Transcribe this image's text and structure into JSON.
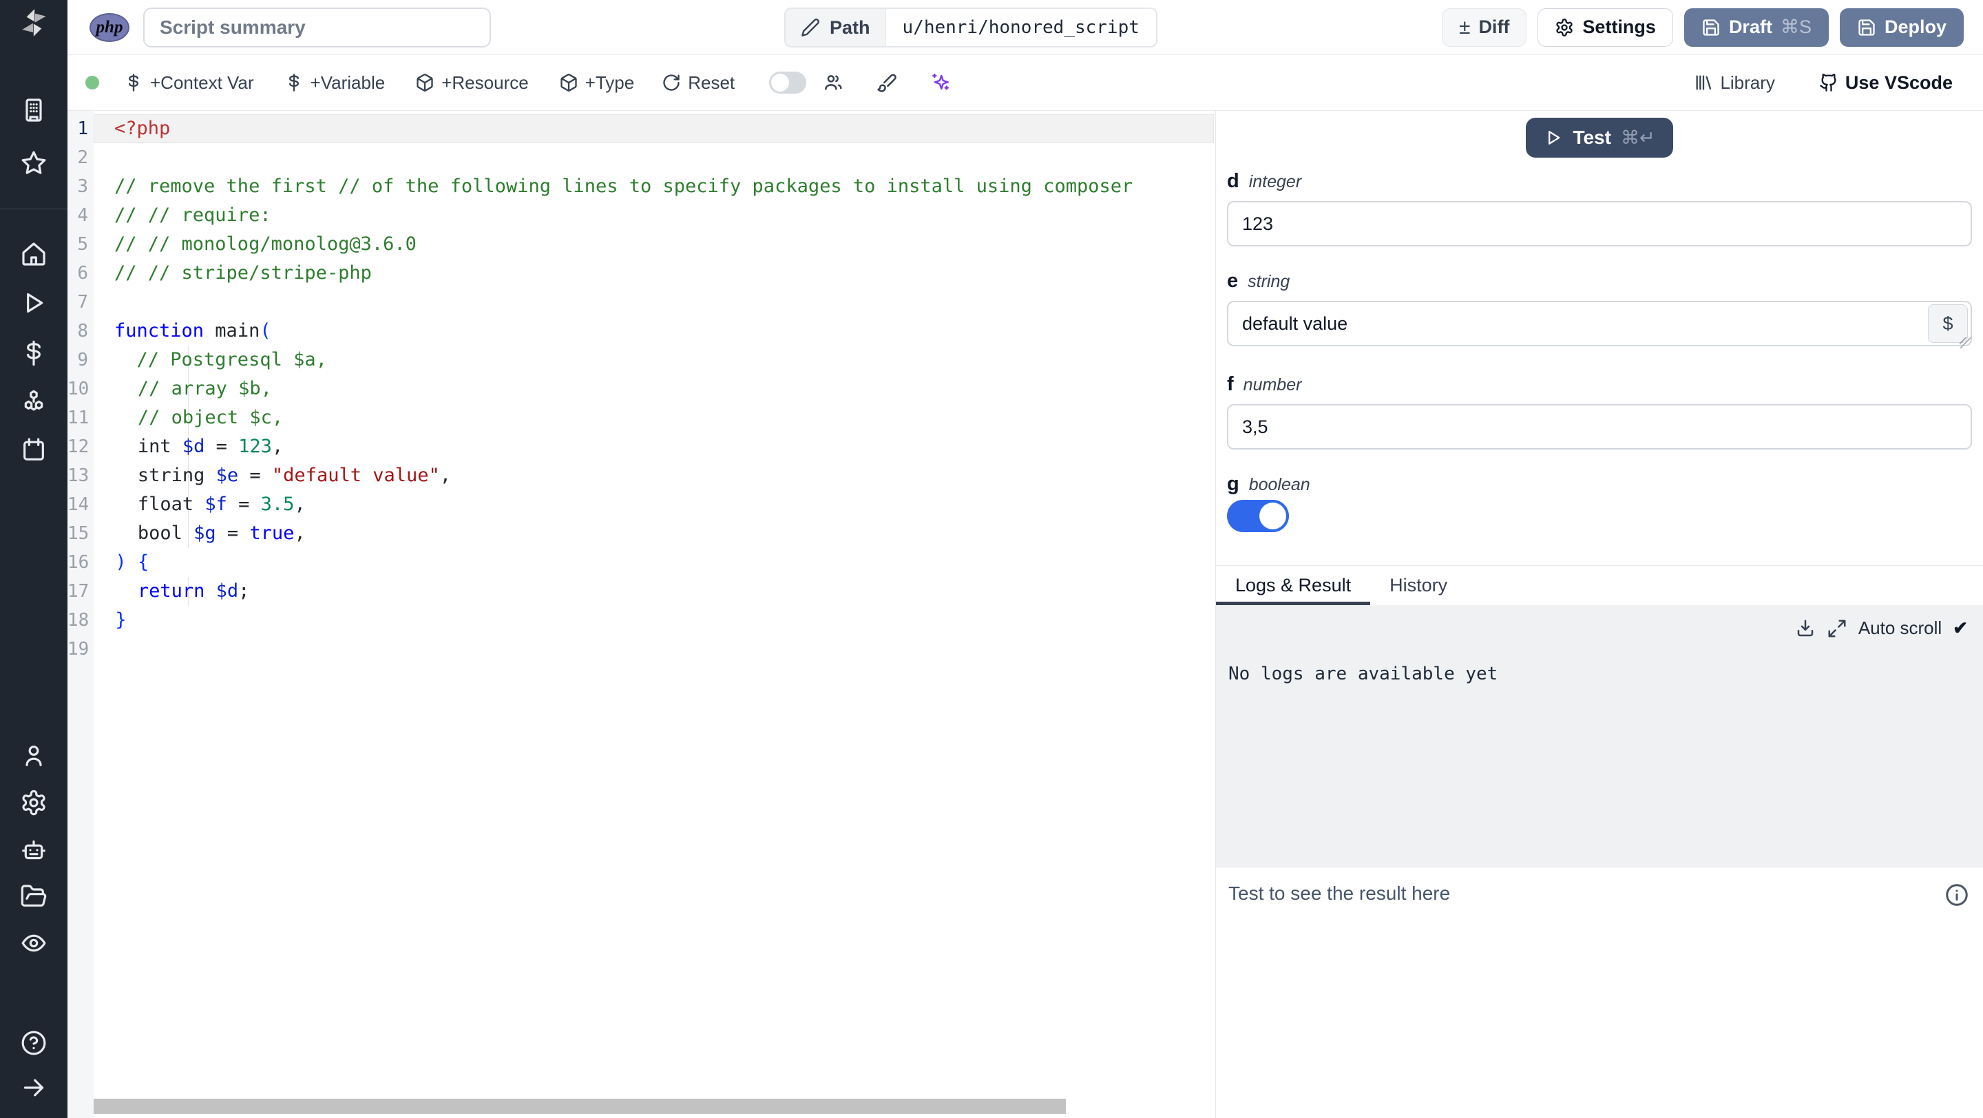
{
  "colors": {
    "sidebar_bg": "#20262f",
    "php_badge": "#777bb3",
    "slate_button": "#66799b",
    "test_button": "#3a4964",
    "toggle_on": "#2f68ea",
    "green_dot": "#7ec488",
    "ai_purple": "#7c3aed",
    "scrollbar": "#c2c2c2"
  },
  "topbar": {
    "language_badge": "php",
    "summary_placeholder": "Script summary",
    "path_label": "Path",
    "path_value": "u/henri/honored_script",
    "diff_label": "Diff",
    "diff_glyph": "±",
    "settings_label": "Settings",
    "draft_label": "Draft",
    "draft_shortcut": "⌘S",
    "deploy_label": "Deploy"
  },
  "toolbar": {
    "add_context_var": "+Context Var",
    "add_variable": "+Variable",
    "add_resource": "+Resource",
    "add_type": "+Type",
    "reset": "Reset",
    "library": "Library",
    "use_vscode": "Use VScode"
  },
  "sidebar_icons": [
    "workspace-building",
    "favorites-star",
    "home",
    "runs-play",
    "variables-dollar",
    "resources-boxes",
    "schedules-calendar",
    "user",
    "settings-gear",
    "ai-bot",
    "folders",
    "audit-eye",
    "help-circle",
    "collapse-arrow"
  ],
  "editor": {
    "token_colors": {
      "phptag": "#bb3434",
      "comment": "#2f7d2f",
      "keyword": "#0000ff",
      "bracket": "#0431fa",
      "variable": "#0a23c8",
      "number": "#098658",
      "string": "#a31515",
      "plain": "#24292f"
    },
    "lines": [
      {
        "n": "1",
        "active": true,
        "tokens": [
          {
            "t": "<?php",
            "c": "phptag"
          }
        ]
      },
      {
        "n": "2",
        "tokens": []
      },
      {
        "n": "3",
        "tokens": [
          {
            "t": "// remove the first // of the following lines to specify packages to install using composer",
            "c": "comment"
          }
        ]
      },
      {
        "n": "4",
        "tokens": [
          {
            "t": "// // require:",
            "c": "comment"
          }
        ]
      },
      {
        "n": "5",
        "tokens": [
          {
            "t": "// // monolog/monolog@3.6.0",
            "c": "comment"
          }
        ]
      },
      {
        "n": "6",
        "tokens": [
          {
            "t": "// // stripe/stripe-php",
            "c": "comment"
          }
        ]
      },
      {
        "n": "7",
        "tokens": []
      },
      {
        "n": "8",
        "tokens": [
          {
            "t": "function",
            "c": "keyword"
          },
          {
            "t": " main",
            "c": "plain"
          },
          {
            "t": "(",
            "c": "bracket"
          }
        ]
      },
      {
        "n": "9",
        "tokens": [
          {
            "t": "  // Postgresql $a,",
            "c": "comment"
          }
        ]
      },
      {
        "n": "10",
        "tokens": [
          {
            "t": "  // array $b,",
            "c": "comment"
          }
        ]
      },
      {
        "n": "11",
        "tokens": [
          {
            "t": "  // object $c,",
            "c": "comment"
          }
        ]
      },
      {
        "n": "12",
        "tokens": [
          {
            "t": "  int ",
            "c": "plain"
          },
          {
            "t": "$d",
            "c": "variable"
          },
          {
            "t": " = ",
            "c": "plain"
          },
          {
            "t": "123",
            "c": "number"
          },
          {
            "t": ",",
            "c": "plain"
          }
        ]
      },
      {
        "n": "13",
        "tokens": [
          {
            "t": "  string ",
            "c": "plain"
          },
          {
            "t": "$e",
            "c": "variable"
          },
          {
            "t": " = ",
            "c": "plain"
          },
          {
            "t": "\"default value\"",
            "c": "string"
          },
          {
            "t": ",",
            "c": "plain"
          }
        ]
      },
      {
        "n": "14",
        "tokens": [
          {
            "t": "  float ",
            "c": "plain"
          },
          {
            "t": "$f",
            "c": "variable"
          },
          {
            "t": " = ",
            "c": "plain"
          },
          {
            "t": "3.5",
            "c": "number"
          },
          {
            "t": ",",
            "c": "plain"
          }
        ]
      },
      {
        "n": "15",
        "tokens": [
          {
            "t": "  bool ",
            "c": "plain"
          },
          {
            "t": "$g",
            "c": "variable"
          },
          {
            "t": " = ",
            "c": "plain"
          },
          {
            "t": "true",
            "c": "keyword"
          },
          {
            "t": ",",
            "c": "plain"
          }
        ]
      },
      {
        "n": "16",
        "tokens": [
          {
            "t": ") {",
            "c": "bracket"
          }
        ]
      },
      {
        "n": "17",
        "tokens": [
          {
            "t": "  ",
            "c": "plain"
          },
          {
            "t": "return",
            "c": "keyword"
          },
          {
            "t": " ",
            "c": "plain"
          },
          {
            "t": "$d",
            "c": "variable"
          },
          {
            "t": ";",
            "c": "plain"
          }
        ]
      },
      {
        "n": "18",
        "tokens": [
          {
            "t": "}",
            "c": "bracket"
          }
        ]
      },
      {
        "n": "19",
        "tokens": []
      }
    ]
  },
  "run_panel": {
    "test_label": "Test",
    "test_shortcut": "⌘↵",
    "fields": [
      {
        "name": "d",
        "type": "integer",
        "value": "123"
      },
      {
        "name": "e",
        "type": "string",
        "value": "default value",
        "suffix_button": "$"
      },
      {
        "name": "f",
        "type": "number",
        "value": "3,5"
      },
      {
        "name": "g",
        "type": "boolean",
        "value": "on"
      }
    ],
    "tabs": {
      "logs": "Logs & Result",
      "history": "History"
    },
    "auto_scroll_label": "Auto scroll",
    "auto_scroll_check": "✔",
    "no_logs_text": "No logs are available yet",
    "result_placeholder": "Test to see the result here"
  }
}
